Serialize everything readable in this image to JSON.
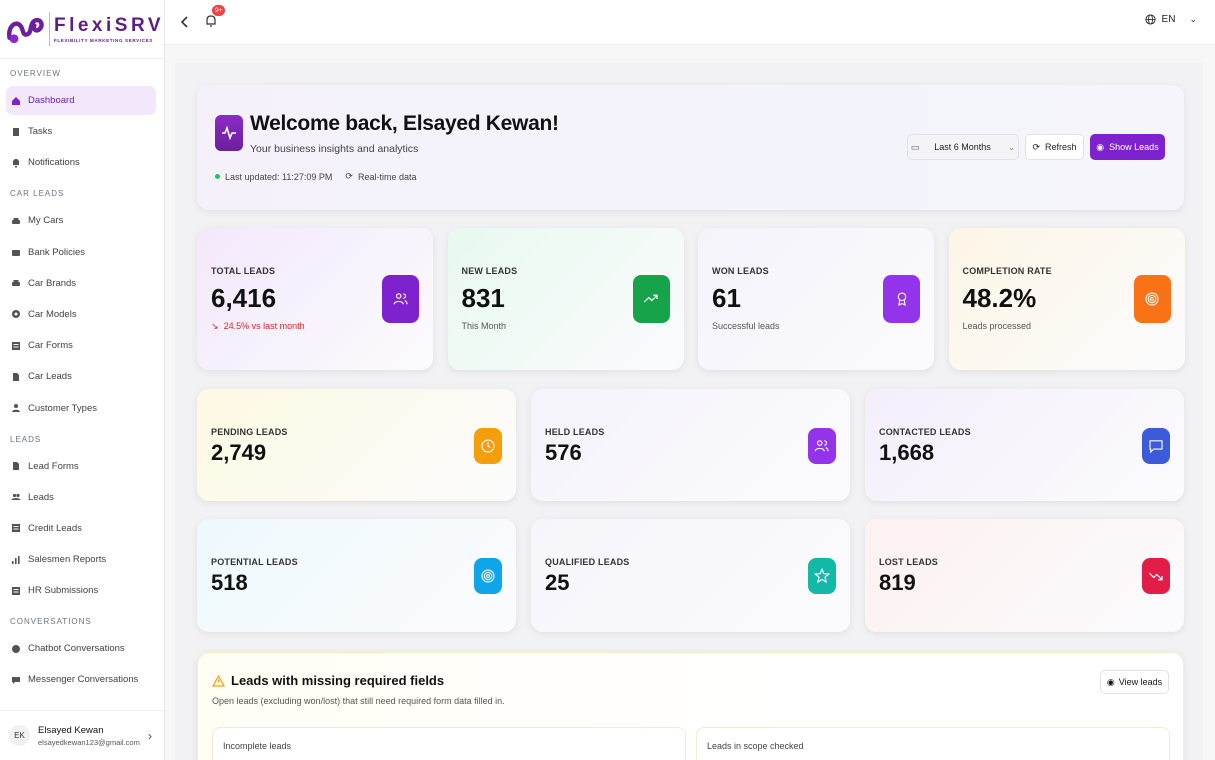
{
  "brand": {
    "name": "FlexiSRV",
    "tagline": "FLEXIBILITY MARKETING SERVICES"
  },
  "sidebar": {
    "sections": [
      {
        "title": "OVERVIEW",
        "items": [
          {
            "label": "Dashboard",
            "icon": "home-icon",
            "active": true
          },
          {
            "label": "Tasks",
            "icon": "clipboard-icon"
          },
          {
            "label": "Notifications",
            "icon": "bell-icon"
          }
        ]
      },
      {
        "title": "CAR LEADS",
        "items": [
          {
            "label": "My Cars",
            "icon": "car-icon"
          },
          {
            "label": "Bank Policies",
            "icon": "bank-icon"
          },
          {
            "label": "Car Brands",
            "icon": "car-icon"
          },
          {
            "label": "Car Models",
            "icon": "gear-icon"
          },
          {
            "label": "Car Forms",
            "icon": "form-icon"
          },
          {
            "label": "Car Leads",
            "icon": "document-icon"
          },
          {
            "label": "Customer Types",
            "icon": "user-icon"
          }
        ]
      },
      {
        "title": "LEADS",
        "items": [
          {
            "label": "Lead Forms",
            "icon": "document-icon"
          },
          {
            "label": "Leads",
            "icon": "users-icon"
          },
          {
            "label": "Credit Leads",
            "icon": "form-icon"
          },
          {
            "label": "Salesmen Reports",
            "icon": "chart-icon"
          },
          {
            "label": "HR Submissions",
            "icon": "form-icon"
          }
        ]
      },
      {
        "title": "CONVERSATIONS",
        "items": [
          {
            "label": "Chatbot Conversations",
            "icon": "bot-icon"
          },
          {
            "label": "Messenger Conversations",
            "icon": "chat-icon"
          }
        ]
      }
    ],
    "user": {
      "initials": "EK",
      "name": "Elsayed Kewan",
      "email": "elsayedkewan123@gmail.com"
    }
  },
  "topbar": {
    "badge": "9+",
    "language": "EN"
  },
  "welcome": {
    "title": "Welcome back, Elsayed Kewan!",
    "subtitle": "Your business insights and analytics",
    "last_updated": "Last updated: 11:27:09 PM",
    "realtime": "Real-time data",
    "range": "Last 6 Months",
    "refresh": "Refresh",
    "show_leads": "Show Leads"
  },
  "stats_top": [
    {
      "label": "TOTAL LEADS",
      "value": "6,416",
      "sub": "24.5% vs last month",
      "trend": "down",
      "bg": "#f3e8fb",
      "color": "#7e22ce",
      "icon": "users-icon"
    },
    {
      "label": "NEW LEADS",
      "value": "831",
      "sub": "This Month",
      "bg": "#e8f9ef",
      "color": "#16a34a",
      "icon": "trending-up-icon"
    },
    {
      "label": "WON LEADS",
      "value": "61",
      "sub": "Successful leads",
      "bg": "#f4f3fb",
      "color": "#9333ea",
      "icon": "award-icon"
    },
    {
      "label": "COMPLETION RATE",
      "value": "48.2%",
      "sub": "Leads processed",
      "bg": "#fdf6e6",
      "color": "#f97316",
      "icon": "target-icon"
    }
  ],
  "stats_mid": [
    {
      "label": "PENDING LEADS",
      "value": "2,749",
      "bg": "#fdf9e2",
      "color": "#f59e0b",
      "icon": "clock-icon"
    },
    {
      "label": "HELD LEADS",
      "value": "576",
      "bg": "#f5f3fb",
      "color": "#9333ea",
      "icon": "users-icon"
    },
    {
      "label": "CONTACTED LEADS",
      "value": "1,668",
      "bg": "#f4effb",
      "color": "#3b5bdb",
      "icon": "message-icon"
    }
  ],
  "stats_bot": [
    {
      "label": "POTENTIAL LEADS",
      "value": "518",
      "bg": "#eef9fd",
      "color": "#0ea5e9",
      "icon": "target-icon"
    },
    {
      "label": "QUALIFIED LEADS",
      "value": "25",
      "bg": "#f5f5fb",
      "color": "#14b8a6",
      "icon": "star-icon"
    },
    {
      "label": "LOST LEADS",
      "value": "819",
      "bg": "#fdf1f1",
      "color": "#e11d48",
      "icon": "trending-down-icon"
    }
  ],
  "missing": {
    "title": "Leads with missing required fields",
    "desc": "Open leads (excluding won/lost) that still need required form data filled in.",
    "view": "View leads",
    "box1": "Incomplete leads",
    "box2": "Leads in scope checked"
  }
}
